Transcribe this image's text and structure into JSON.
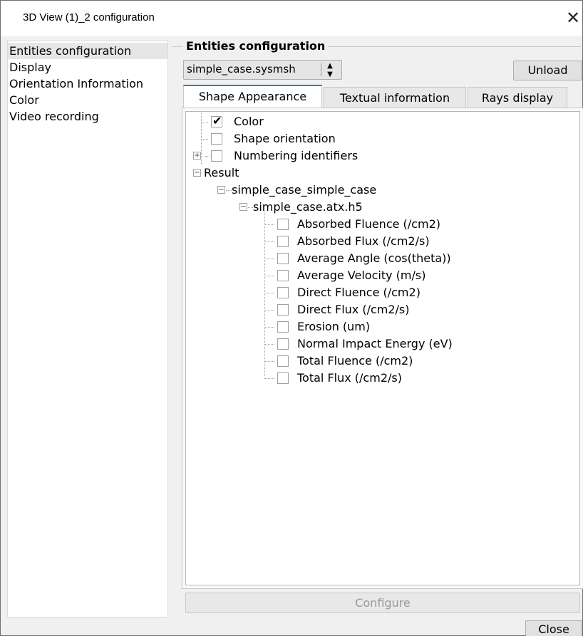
{
  "window": {
    "title": "3D View (1)_2 configuration",
    "close_glyph": "✕"
  },
  "sidebar": {
    "items": [
      {
        "label": "Entities configuration",
        "selected": true
      },
      {
        "label": "Display"
      },
      {
        "label": "Orientation Information"
      },
      {
        "label": "Color"
      },
      {
        "label": "Video recording"
      }
    ]
  },
  "entities": {
    "group_title": "Entities configuration",
    "file_select": {
      "value": "simple_case.sysmsh"
    },
    "unload_label": "Unload"
  },
  "tabs": [
    {
      "label": "Shape Appearance",
      "active": true
    },
    {
      "label": "Textual information"
    },
    {
      "label": "Rays display"
    }
  ],
  "tree": {
    "color": {
      "label": "Color",
      "checked": true
    },
    "shape_orientation": {
      "label": "Shape orientation",
      "checked": false
    },
    "numbering_identifiers": {
      "label": "Numbering identifiers",
      "checked": false
    },
    "result": {
      "label": "Result"
    },
    "case": {
      "label": "simple_case_simple_case"
    },
    "file": {
      "label": "simple_case.atx.h5"
    },
    "results": [
      {
        "label": "Absorbed Fluence (/cm2)"
      },
      {
        "label": "Absorbed Flux (/cm2/s)"
      },
      {
        "label": "Average Angle (cos(theta))"
      },
      {
        "label": "Average Velocity (m/s)"
      },
      {
        "label": "Direct Fluence (/cm2)"
      },
      {
        "label": "Direct Flux (/cm2/s)"
      },
      {
        "label": "Erosion (um)"
      },
      {
        "label": "Normal Impact Energy (eV)"
      },
      {
        "label": "Total Fluence (/cm2)"
      },
      {
        "label": "Total Flux (/cm2/s)"
      }
    ]
  },
  "footer": {
    "configure_label": "Configure",
    "close_label": "Close"
  }
}
